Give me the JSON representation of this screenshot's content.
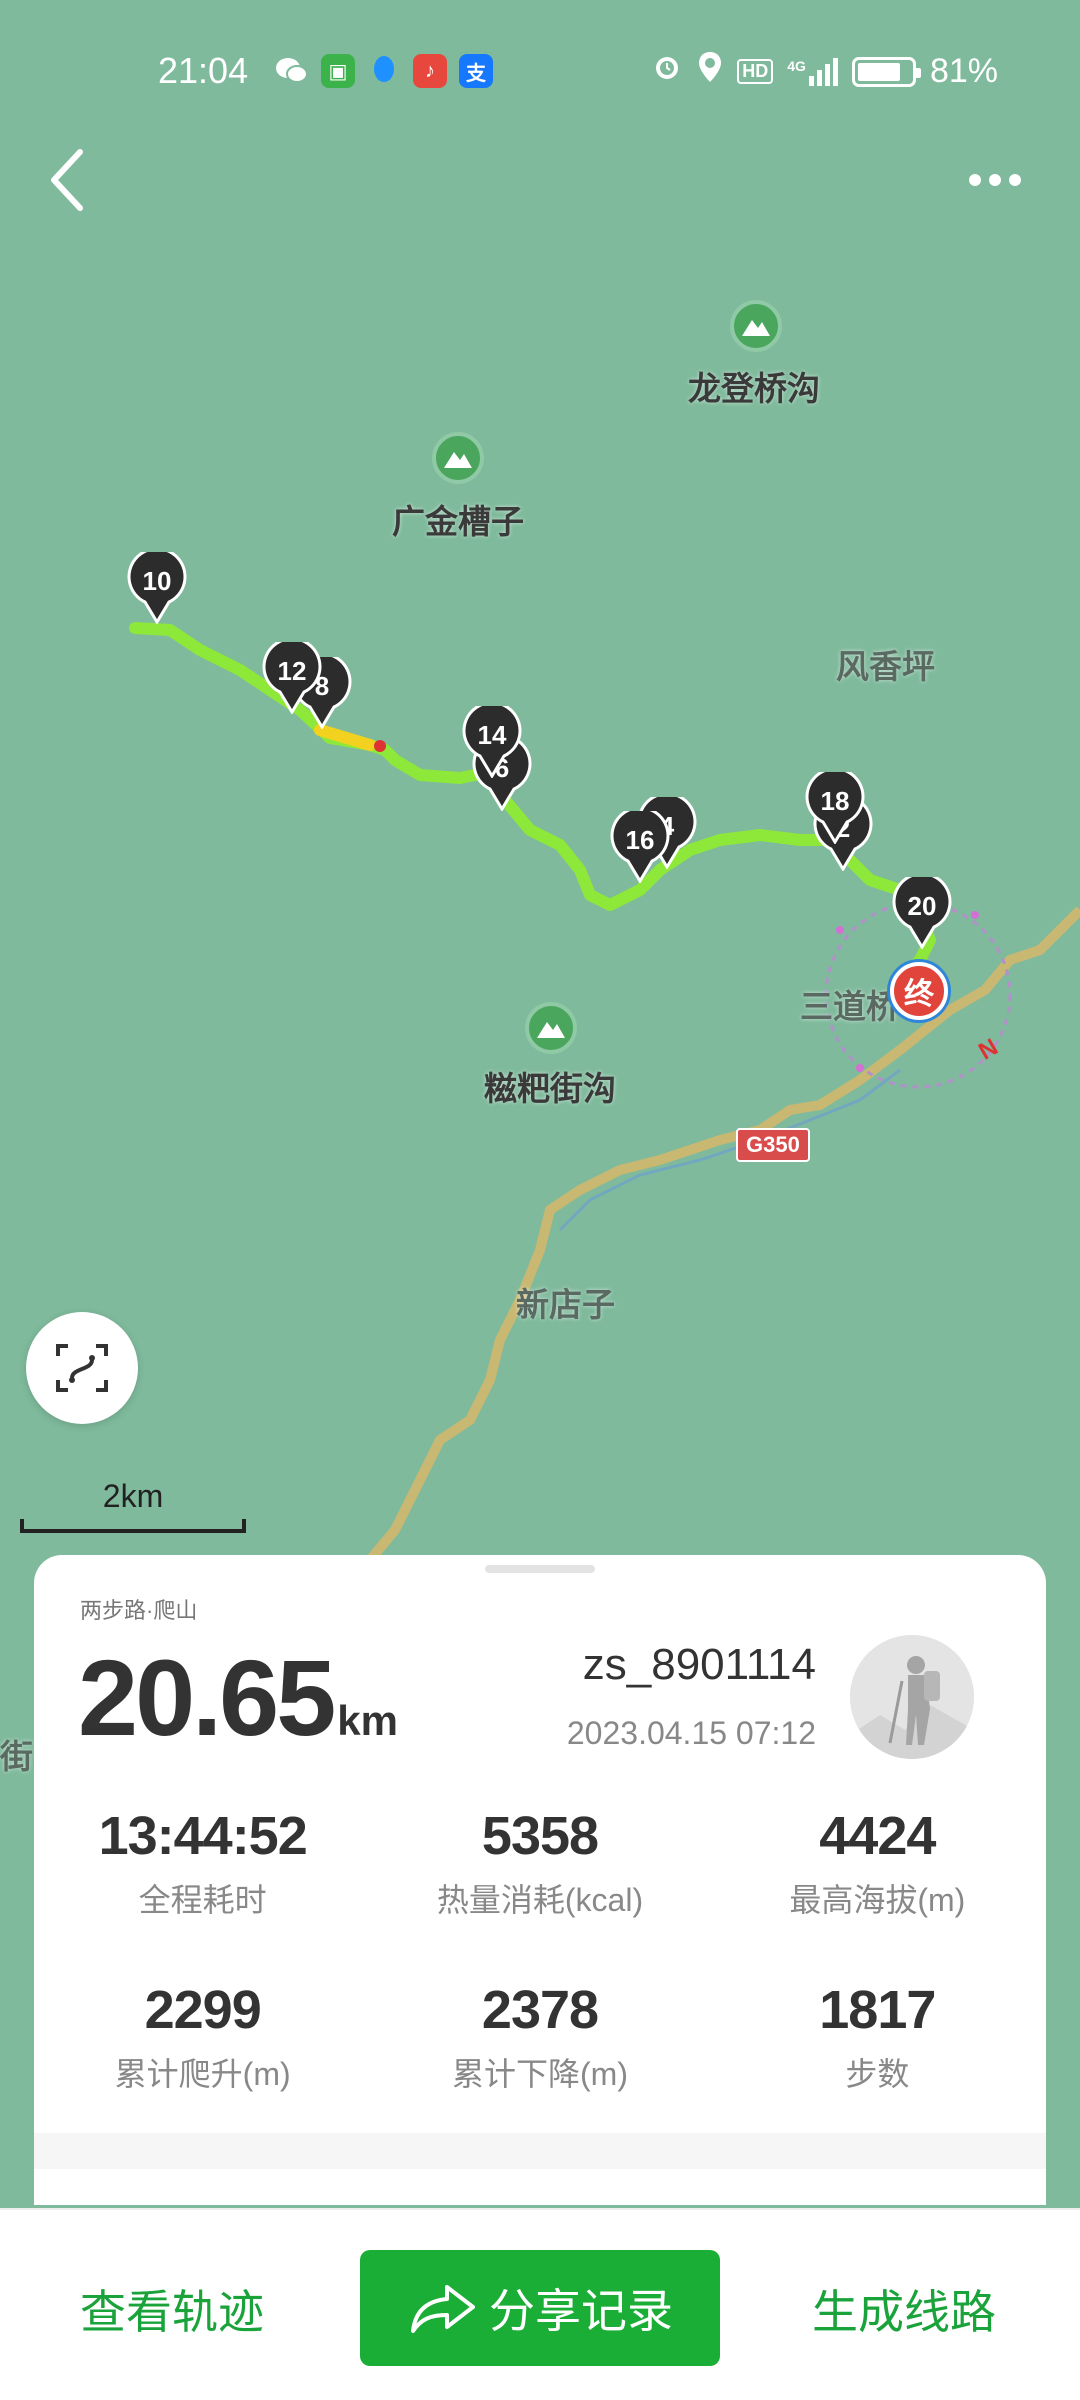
{
  "status": {
    "time": "21:04",
    "battery": "81%",
    "battery_level": 0.81,
    "network": "4G"
  },
  "map": {
    "places": {
      "longdengqiaogou": "龙登桥沟",
      "guangjincaozi": "广金槽子",
      "fengxiangping": "风香坪",
      "sandaoqiao": "三道桥",
      "ciba_jiegou": "糍粑街沟",
      "xindianzi": "新店子",
      "jie": "街"
    },
    "road_badge": "G350",
    "end_marker": "终",
    "compass": "N",
    "waypoints": [
      "10",
      "8",
      "12",
      "6",
      "14",
      "4",
      "16",
      "2",
      "18",
      "20"
    ],
    "scale": "2km"
  },
  "card": {
    "sport": "两步路·爬山",
    "distance_value": "20.65",
    "distance_unit": "km",
    "user": "zs_8901114",
    "date": "2023.04.15 07:12",
    "stats": [
      {
        "value": "13:44:52",
        "label": "全程耗时"
      },
      {
        "value": "5358",
        "label": "热量消耗(kcal)"
      },
      {
        "value": "4424",
        "label": "最高海拔(m)"
      },
      {
        "value": "2299",
        "label": "累计爬升(m)"
      },
      {
        "value": "2378",
        "label": "累计下降(m)"
      },
      {
        "value": "1817",
        "label": "步数"
      }
    ]
  },
  "actions": {
    "view_track": "查看轨迹",
    "share": "分享记录",
    "create_route": "生成线路"
  },
  "colors": {
    "map_bg": "#7fba9c",
    "track": "#8ee83a",
    "accent": "#1aae37"
  }
}
